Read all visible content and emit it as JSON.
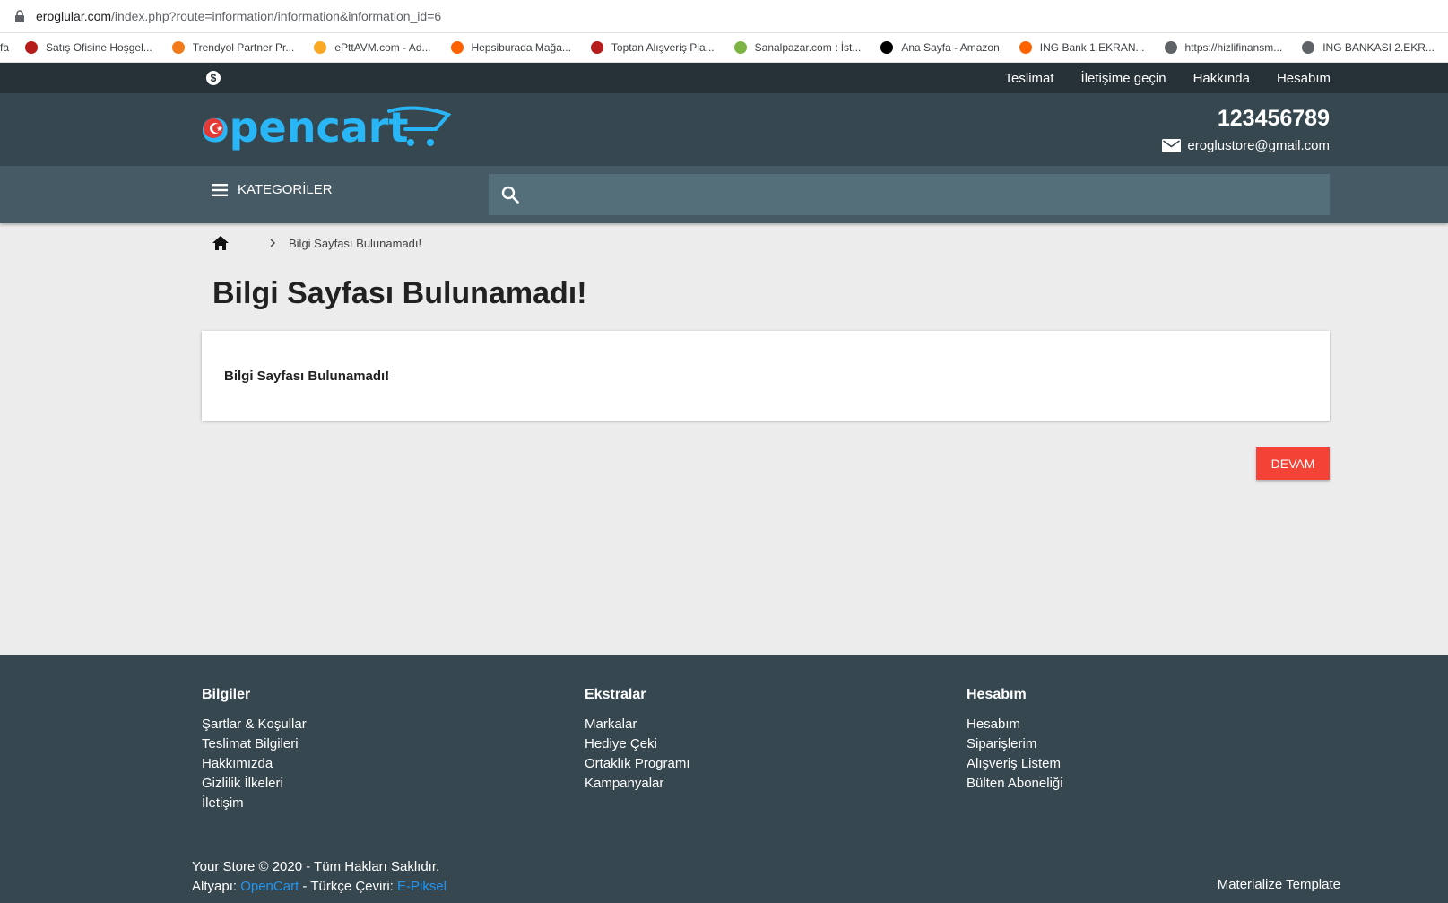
{
  "browser": {
    "url_domain": "eroglular.com",
    "url_path": "/index.php?route=information/information&information_id=6",
    "bookmarks": [
      {
        "label": "fa",
        "color": ""
      },
      {
        "label": "Satış Ofisine Hoşgel...",
        "color": "#b71c1c"
      },
      {
        "label": "Trendyol Partner Pr...",
        "color": "#f27a1a"
      },
      {
        "label": "ePttAVM.com - Ad...",
        "color": "#f9a825"
      },
      {
        "label": "Hepsiburada Mağa...",
        "color": "#ff6000"
      },
      {
        "label": "Toptan Alışveriş Pla...",
        "color": "#b71c1c"
      },
      {
        "label": "Sanalpazar.com : İst...",
        "color": "#7cb342"
      },
      {
        "label": "Ana Sayfa - Amazon",
        "color": "#000000"
      },
      {
        "label": "ING Bank 1.EKRAN...",
        "color": "#ff6200"
      },
      {
        "label": "https://hizlifinansm...",
        "color": "#5f6368"
      },
      {
        "label": "ING BANKASI 2.EKR...",
        "color": "#5f6368"
      }
    ]
  },
  "topbar": {
    "currency_symbol": "$",
    "links": [
      "Teslimat",
      "İletişime geçin",
      "Hakkında",
      "Hesabım"
    ]
  },
  "header": {
    "logo_text": "opencart",
    "phone": "123456789",
    "email": "eroglustore@gmail.com"
  },
  "nav": {
    "categories_label": "KATEGORİLER",
    "search_placeholder": ""
  },
  "breadcrumb": {
    "current": "Bilgi Sayfası Bulunamadı!"
  },
  "page": {
    "title": "Bilgi Sayfası Bulunamadı!",
    "message": "Bilgi Sayfası Bulunamadı!",
    "continue_label": "DEVAM"
  },
  "footer": {
    "columns": [
      {
        "title": "Bilgiler",
        "links": [
          "Şartlar & Koşullar",
          "Teslimat Bilgileri",
          "Hakkımızda",
          "Gizlilik İlkeleri",
          "İletişim"
        ]
      },
      {
        "title": "Ekstralar",
        "links": [
          "Markalar",
          "Hediye Çeki",
          "Ortaklık Programı",
          "Kampanyalar"
        ]
      },
      {
        "title": "Hesabım",
        "links": [
          "Hesabım",
          "Siparişlerim",
          "Alışveriş Listem",
          "Bülten Aboneliği"
        ]
      }
    ],
    "copyright": "Your Store © 2020 - Tüm Hakları Saklıdır.",
    "powered_prefix": "Altyapı:",
    "powered_link": "OpenCart",
    "translation_prefix": "- Türkçe Çeviri:",
    "translation_link": "E-Piksel",
    "template": "Materialize Template"
  },
  "colors": {
    "topbar": "#263238",
    "header": "#37474f",
    "navbar": "#455a64",
    "search": "#546e7a",
    "accent_button": "#f44336",
    "logo": "#29b6f6",
    "link": "#2196f3"
  },
  "icons": [
    "lock-icon",
    "currency-icon",
    "mail-icon",
    "menu-icon",
    "search-icon",
    "home-icon",
    "chevron-right-icon"
  ]
}
